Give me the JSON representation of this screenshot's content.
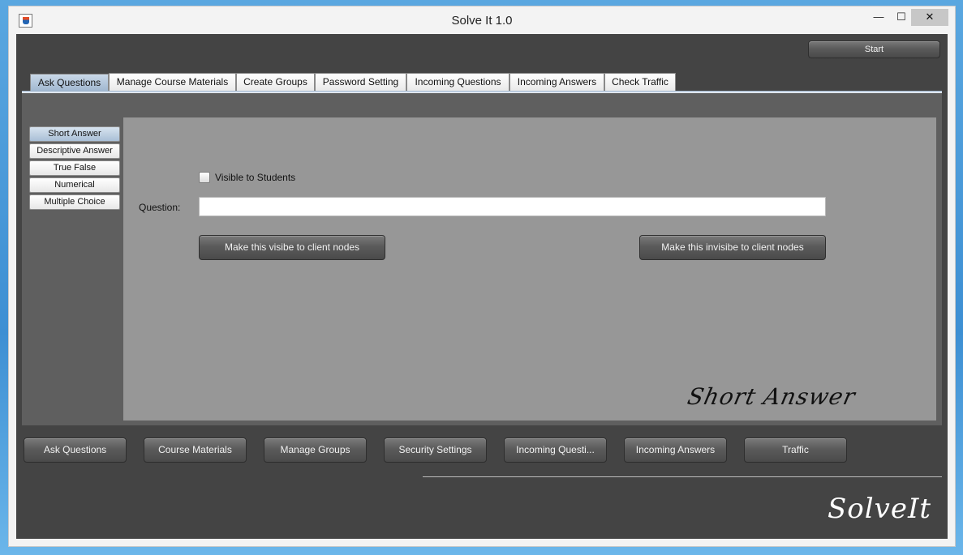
{
  "window": {
    "title": "Solve It 1.0",
    "controls": {
      "minimize": "—",
      "maximize": "☐",
      "close": "✕"
    }
  },
  "header": {
    "start_label": "Start"
  },
  "tabs": [
    {
      "label": "Ask Questions",
      "active": true
    },
    {
      "label": "Manage Course Materials",
      "active": false
    },
    {
      "label": "Create Groups",
      "active": false
    },
    {
      "label": "Password Setting",
      "active": false
    },
    {
      "label": "Incoming Questions",
      "active": false
    },
    {
      "label": "Incoming Answers",
      "active": false
    },
    {
      "label": "Check Traffic",
      "active": false
    }
  ],
  "question_types": [
    {
      "label": "Short Answer",
      "active": true
    },
    {
      "label": "Descriptive Answer",
      "active": false
    },
    {
      "label": "True False",
      "active": false
    },
    {
      "label": "Numerical",
      "active": false
    },
    {
      "label": "Multiple Choice",
      "active": false
    }
  ],
  "form": {
    "visible_checkbox_label": "Visible to Students",
    "visible_checked": false,
    "question_label": "Question:",
    "question_value": "",
    "make_visible_label": "Make this visibe to client nodes",
    "make_invisible_label": "Make this invisibe to client nodes",
    "panel_caption": "Short Answer"
  },
  "bottom_nav": [
    {
      "label": "Ask Questions"
    },
    {
      "label": "Course Materials"
    },
    {
      "label": "Manage Groups"
    },
    {
      "label": "Security Settings"
    },
    {
      "label": "Incoming Questi..."
    },
    {
      "label": "Incoming Answers"
    },
    {
      "label": "Traffic"
    }
  ],
  "brand": "SolveIt",
  "colors": {
    "background_dark": "#444444",
    "panel": "#5f5f5f",
    "content": "#979797",
    "active_tab": "#a9bfd6"
  }
}
